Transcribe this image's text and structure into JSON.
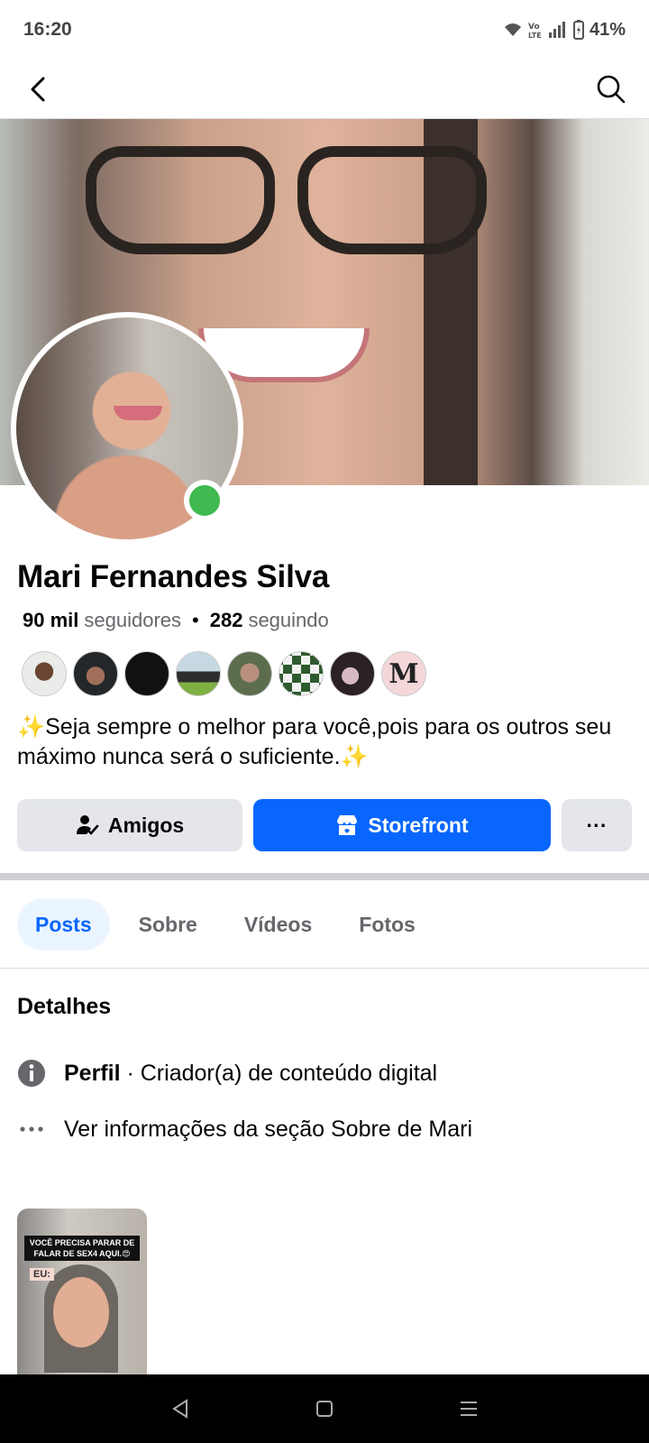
{
  "status": {
    "time": "16:20",
    "battery": "41%"
  },
  "header": {
    "back_icon": "back-arrow-icon",
    "search_icon": "search-icon"
  },
  "profile": {
    "name": "Mari Fernandes Silva",
    "followers_count": "90 mil",
    "followers_label": "seguidores",
    "separator": "•",
    "following_count": "282",
    "following_label": "seguindo",
    "bio": "✨Seja sempre o melhor para você,pois para os outros seu máximo nunca será o suficiente.✨",
    "online": true,
    "follower_avatar_m_letter": "M"
  },
  "actions": {
    "friends_label": "Amigos",
    "storefront_label": "Storefront",
    "more_label": "···"
  },
  "tabs": [
    {
      "label": "Posts",
      "active": true
    },
    {
      "label": "Sobre",
      "active": false
    },
    {
      "label": "Vídeos",
      "active": false
    },
    {
      "label": "Fotos",
      "active": false
    }
  ],
  "details": {
    "title": "Detalhes",
    "profile_label": "Perfil",
    "profile_text": "· Criador(a) de conteúdo digital",
    "about_link": "Ver informações da seção Sobre de Mari"
  },
  "post": {
    "caption": "VOCÊ PRECISA PARAR DE FALAR DE SEX4 AQUI.😍",
    "tag": "EU:"
  },
  "colors": {
    "accent": "#0866ff",
    "online": "#3fb950",
    "button_gray": "#e4e6eb"
  }
}
